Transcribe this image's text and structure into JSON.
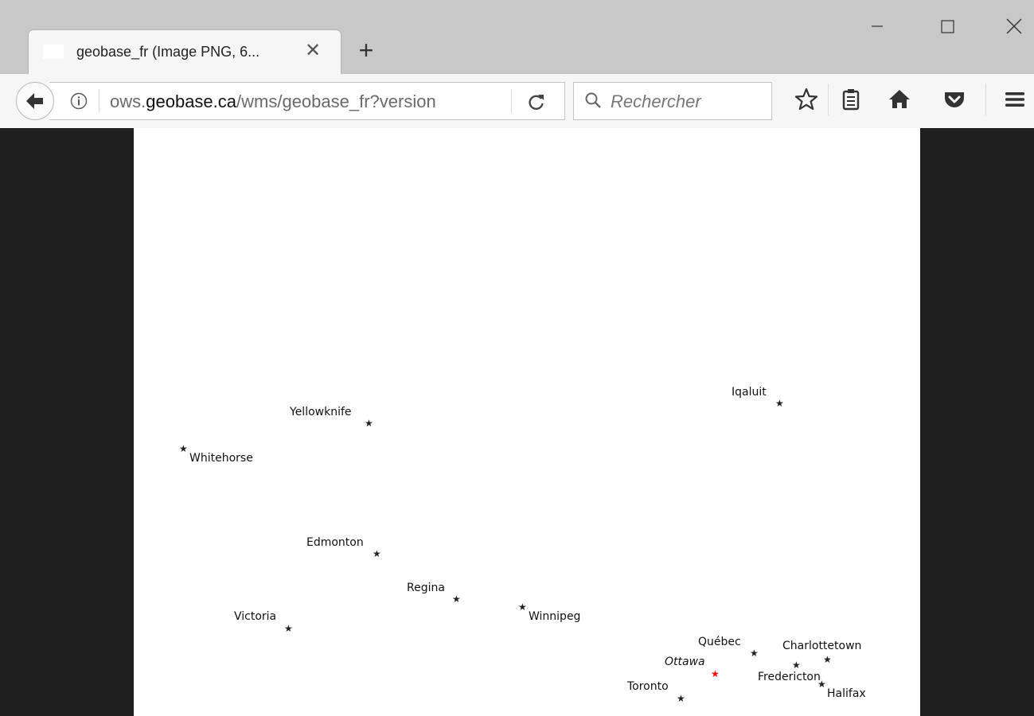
{
  "window": {
    "minimize_symbol": "—",
    "close_symbol": "✕"
  },
  "tab": {
    "title": "geobase_fr (Image PNG, 6...",
    "close_symbol": "✕"
  },
  "new_tab_symbol": "+",
  "urlbar": {
    "url_domain": "ows.geobase.ca",
    "url_domain_prefix": "ows.",
    "url_domain_main": "geobase.ca",
    "url_path": "/wms/geobase_fr?version"
  },
  "searchbar": {
    "placeholder": "Rechercher"
  },
  "toolbar_icons": [
    "bookmark-star-icon",
    "reading-list-icon",
    "home-icon",
    "pocket-icon",
    "menu-icon"
  ],
  "map": {
    "marker_symbol": "★",
    "capital_color": "#ff0000",
    "city_color": "#222222",
    "cities": [
      {
        "name": "Iqaluit",
        "capital": false
      },
      {
        "name": "Yellowknife",
        "capital": false
      },
      {
        "name": "Whitehorse",
        "capital": false
      },
      {
        "name": "Edmonton",
        "capital": false
      },
      {
        "name": "Regina",
        "capital": false
      },
      {
        "name": "Winnipeg",
        "capital": false
      },
      {
        "name": "Victoria",
        "capital": false
      },
      {
        "name": "Québec",
        "capital": false
      },
      {
        "name": "Charlottetown",
        "capital": false
      },
      {
        "name": "Ottawa",
        "capital": true
      },
      {
        "name": "Fredericton",
        "capital": false
      },
      {
        "name": "Toronto",
        "capital": false
      },
      {
        "name": "Halifax",
        "capital": false
      }
    ]
  }
}
